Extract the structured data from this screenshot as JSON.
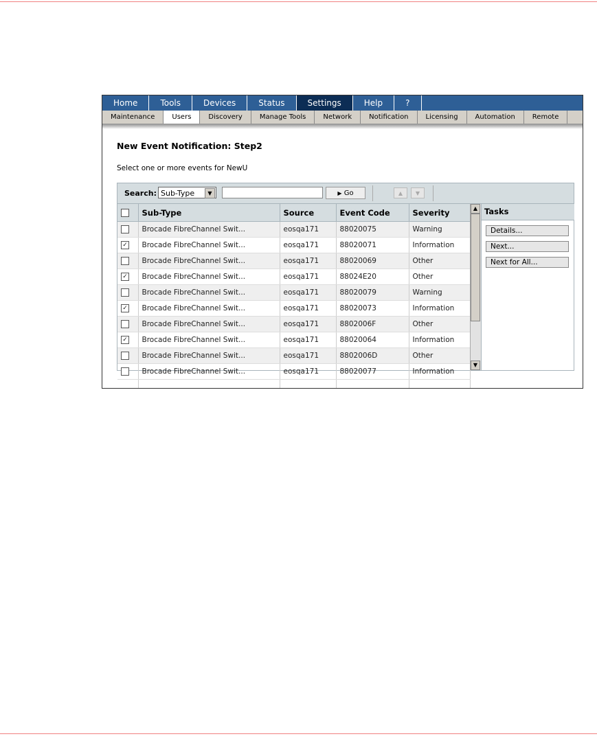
{
  "nav": {
    "items": [
      "Home",
      "Tools",
      "Devices",
      "Status",
      "Settings",
      "Help",
      "?"
    ],
    "active": "Settings"
  },
  "subnav": {
    "items": [
      "Maintenance",
      "Users",
      "Discovery",
      "Manage Tools",
      "Network",
      "Notification",
      "Licensing",
      "Automation",
      "Remote"
    ],
    "active": "Users"
  },
  "page": {
    "title": "New Event Notification: Step2",
    "subtitle": "Select one or more events for NewU"
  },
  "search": {
    "label": "Search:",
    "field": "Sub-Type",
    "value": "",
    "go_label": "Go"
  },
  "table": {
    "columns": [
      "Sub-Type",
      "Source",
      "Event Code",
      "Severity"
    ],
    "rows": [
      {
        "checked": false,
        "subtype": "Brocade FibreChannel Swit...",
        "source": "eosqa171",
        "code": "88020075",
        "severity": "Warning"
      },
      {
        "checked": true,
        "subtype": "Brocade FibreChannel Swit...",
        "source": "eosqa171",
        "code": "88020071",
        "severity": "Information"
      },
      {
        "checked": false,
        "subtype": "Brocade FibreChannel Swit...",
        "source": "eosqa171",
        "code": "88020069",
        "severity": "Other"
      },
      {
        "checked": true,
        "subtype": "Brocade FibreChannel Swit...",
        "source": "eosqa171",
        "code": "88024E20",
        "severity": "Other"
      },
      {
        "checked": false,
        "subtype": "Brocade FibreChannel Swit...",
        "source": "eosqa171",
        "code": "88020079",
        "severity": "Warning"
      },
      {
        "checked": true,
        "subtype": "Brocade FibreChannel Swit...",
        "source": "eosqa171",
        "code": "88020073",
        "severity": "Information"
      },
      {
        "checked": false,
        "subtype": "Brocade FibreChannel Swit...",
        "source": "eosqa171",
        "code": "8802006F",
        "severity": "Other"
      },
      {
        "checked": true,
        "subtype": "Brocade FibreChannel Swit...",
        "source": "eosqa171",
        "code": "88020064",
        "severity": "Information"
      },
      {
        "checked": false,
        "subtype": "Brocade FibreChannel Swit...",
        "source": "eosqa171",
        "code": "8802006D",
        "severity": "Other"
      },
      {
        "checked": false,
        "subtype": "Brocade FibreChannel Swit...",
        "source": "eosqa171",
        "code": "88020077",
        "severity": "Information"
      }
    ]
  },
  "tasks": {
    "title": "Tasks",
    "buttons": [
      "Details...",
      "Next...",
      "Next for All..."
    ]
  }
}
